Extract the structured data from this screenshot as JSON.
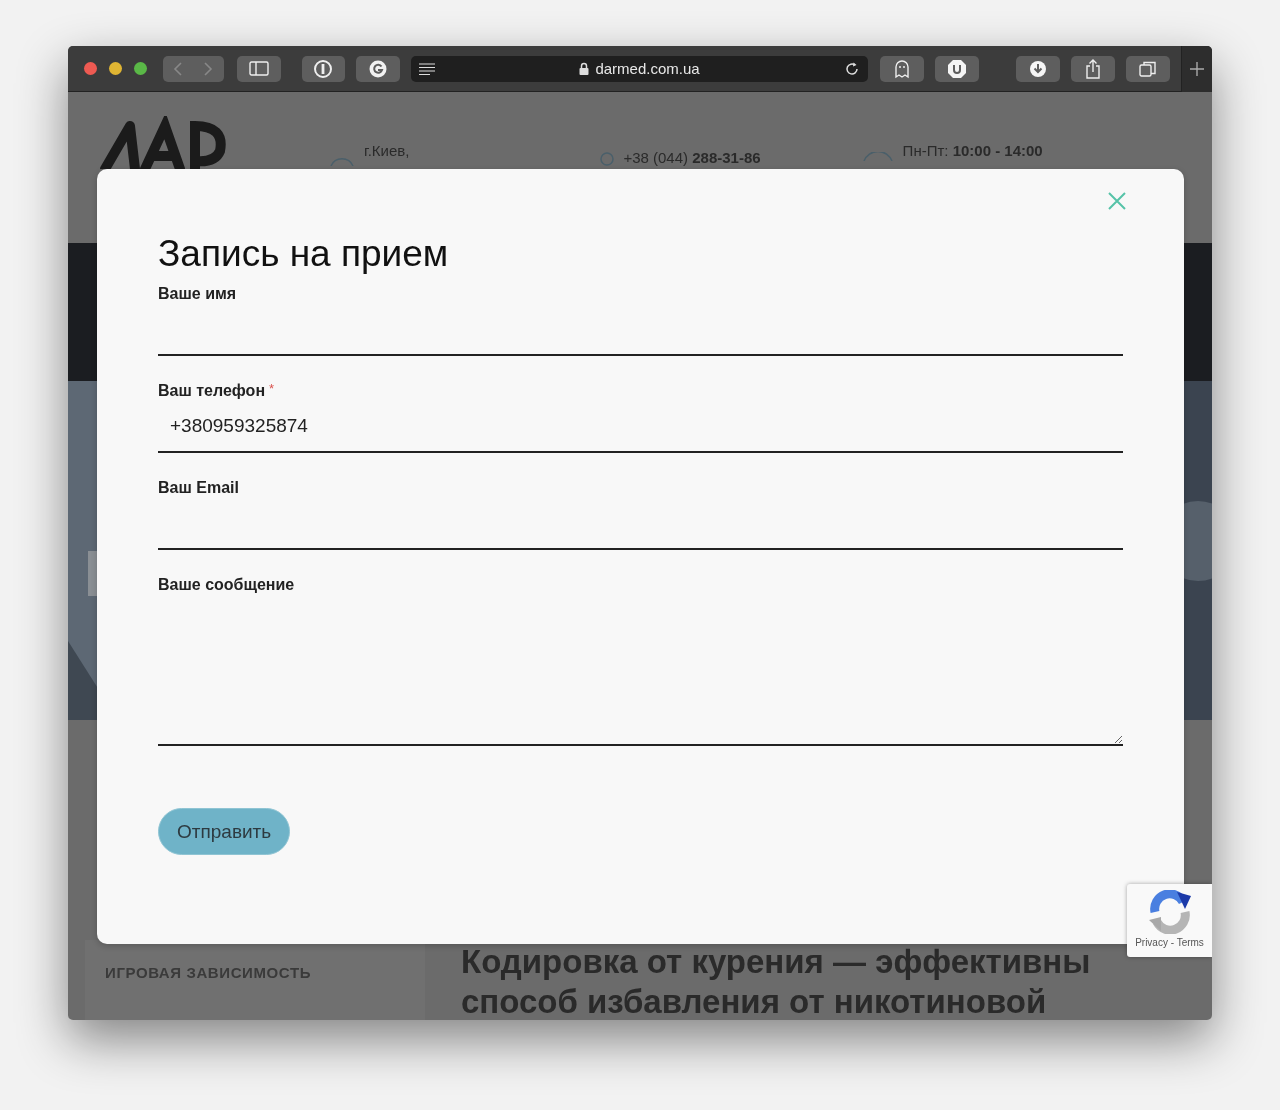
{
  "browser": {
    "url": "darmed.com.ua"
  },
  "page": {
    "address": "г.Киев,",
    "phone": "+38 (044) **288-31-86**",
    "hours": "Пн-Пт: **10:00 - 14:00**",
    "sidebar_item": "ИГРОВАЯ ЗАВИСИМОСТЬ",
    "article_title_lines": [
      "Кодировка от курения — эффективны",
      "способ избавления от никотиновой"
    ]
  },
  "modal": {
    "title": "Запись на прием",
    "fields": [
      {
        "label": "Ваше имя",
        "kind": "input"
      },
      {
        "label": "Ваш телефон",
        "required_mark": "*",
        "value": "+380959325874",
        "kind": "input"
      },
      {
        "label": "Ваш Email",
        "kind": "input"
      },
      {
        "label": "Ваше сообщение",
        "kind": "textarea"
      }
    ],
    "submit": "Отправить"
  },
  "recaptcha": {
    "links": "Privacy - Terms"
  }
}
